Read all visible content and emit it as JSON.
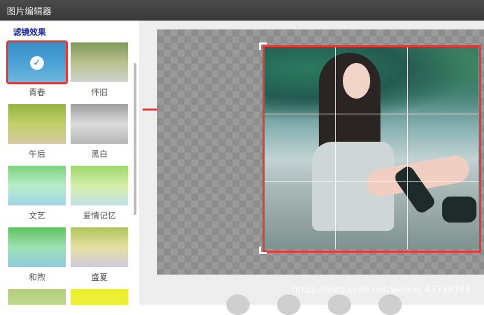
{
  "window": {
    "title": "图片编辑器"
  },
  "sidebar": {
    "section_label": "滤镜效果",
    "filters": [
      {
        "label": "青春",
        "selected": true
      },
      {
        "label": "怀旧",
        "selected": false
      },
      {
        "label": "午后",
        "selected": false
      },
      {
        "label": "黑白",
        "selected": false
      },
      {
        "label": "文艺",
        "selected": false
      },
      {
        "label": "爱情记忆",
        "selected": false
      },
      {
        "label": "和煦",
        "selected": false
      },
      {
        "label": "盛夏",
        "selected": false
      },
      {
        "label": "",
        "selected": false
      },
      {
        "label": "",
        "selected": false
      }
    ]
  },
  "toolbar": {
    "icons": [
      "rotate-left-icon",
      "rotate-right-icon",
      "flip-icon",
      "send-icon"
    ]
  },
  "watermark": "https://blog.csdn.net/weixin_43739189",
  "colors": {
    "selection": "#e53935",
    "section_label": "#1a2aa8"
  }
}
